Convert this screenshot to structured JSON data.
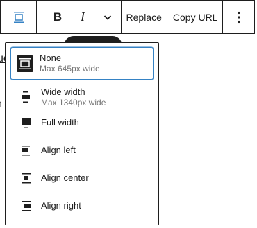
{
  "toolbar": {
    "align_icon": "align-none-icon",
    "bold_label": "B",
    "italic_label": "I",
    "more_format_icon": "chevron-down-icon",
    "replace_label": "Replace",
    "copy_url_label": "Copy URL",
    "options_icon": "more-vertical-icon",
    "accent": "#3582c4"
  },
  "background": {
    "text_fragment_1": "ue",
    "text_fragment_2": "n"
  },
  "menu": {
    "items": [
      {
        "label": "None",
        "sublabel": "Max 645px wide",
        "icon": "align-none-icon",
        "selected": true
      },
      {
        "label": "Wide width",
        "sublabel": "Max 1340px wide",
        "icon": "align-wide-icon",
        "selected": false
      },
      {
        "label": "Full width",
        "sublabel": "",
        "icon": "align-full-width-icon",
        "selected": false
      },
      {
        "label": "Align left",
        "sublabel": "",
        "icon": "align-left-icon",
        "selected": false
      },
      {
        "label": "Align center",
        "sublabel": "",
        "icon": "align-center-icon",
        "selected": false
      },
      {
        "label": "Align right",
        "sublabel": "",
        "icon": "align-right-icon",
        "selected": false
      }
    ]
  }
}
